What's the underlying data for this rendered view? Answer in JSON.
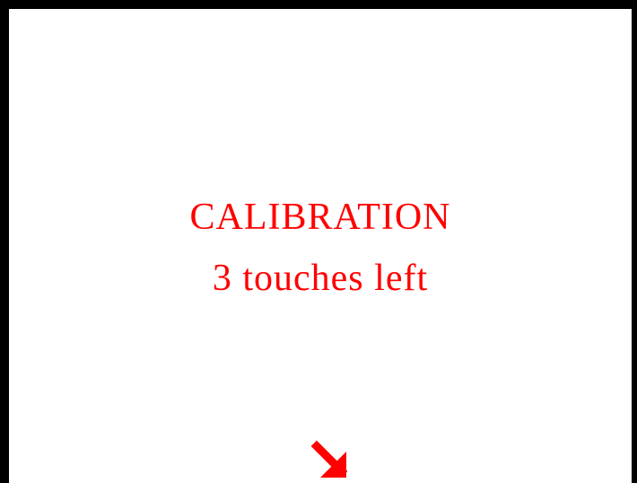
{
  "calibration": {
    "title": "CALIBRATION",
    "status": "3 touches left",
    "target_icon": "arrow-down-right-icon"
  },
  "colors": {
    "background": "#ffffff",
    "frame": "#000000",
    "accent": "#ff0000"
  }
}
